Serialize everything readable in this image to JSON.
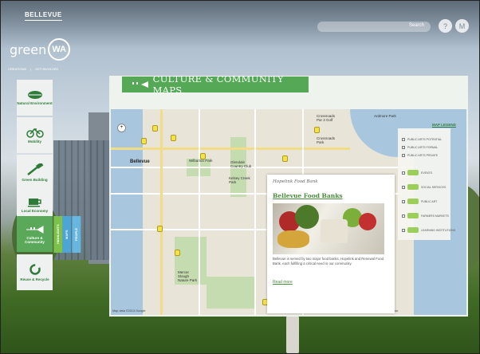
{
  "header": {
    "city": "BELLEVUE",
    "logo_text": "green",
    "logo_badge": "WA",
    "link_1": "CREATIONS",
    "link_2": "GET INVOLVED",
    "search_placeholder": "Search",
    "btn_1": "?",
    "btn_2": "M"
  },
  "sidebar": {
    "items": [
      {
        "label": "Natural Environment",
        "icon": "leaf-icon"
      },
      {
        "label": "Mobility",
        "icon": "bicycle-icon"
      },
      {
        "label": "Green Building",
        "icon": "hammer-icon"
      },
      {
        "label": "Local Economy",
        "icon": "coffee-cup-icon"
      },
      {
        "label": "Culture & Community",
        "icon": "trumpet-icon"
      },
      {
        "label": "Reuse & Recycle",
        "icon": "recycle-icon"
      }
    ],
    "subtabs": [
      "HIGHLIGHTS",
      "MAPS",
      "PEOPLE"
    ]
  },
  "panel": {
    "title": "CULTURE & COMMUNITY MAPS"
  },
  "map": {
    "legend_link": "MAP LEGEND",
    "legend_items": [
      "PUBLIC ARTS POTENTIAL",
      "PUBLIC ARTS FORMAL",
      "PUBLIC ARTS PRIVATE",
      "EVENTS",
      "SOCIAL SERVICES",
      "PUBLIC ART",
      "FARMERS MARKETS",
      "LEARNING INSTITUTIONS"
    ],
    "labels": {
      "city": "Bellevue",
      "p1": "Wilburton Park",
      "p2": "Glendale Country Club",
      "p3": "Kelsey Creek Park",
      "p4": "Crossroads Par 3 Golf",
      "p5": "Crossroads Park",
      "p6": "Mercer Slough Nature Park",
      "p7": "Ardmore Park"
    },
    "attribution_left": "Map data ©2013 Google",
    "attribution_right": "Map data ©2013 Google · Terms of Use · Report a map error"
  },
  "popup": {
    "kicker": "Hopelink Food Bank",
    "title": "Bellevue Food Banks",
    "description": "Bellevue is served by two major food banks, Hopelink and Renewal Food Bank, each fulfilling a critical need in our community.",
    "read_more": "Read more"
  }
}
